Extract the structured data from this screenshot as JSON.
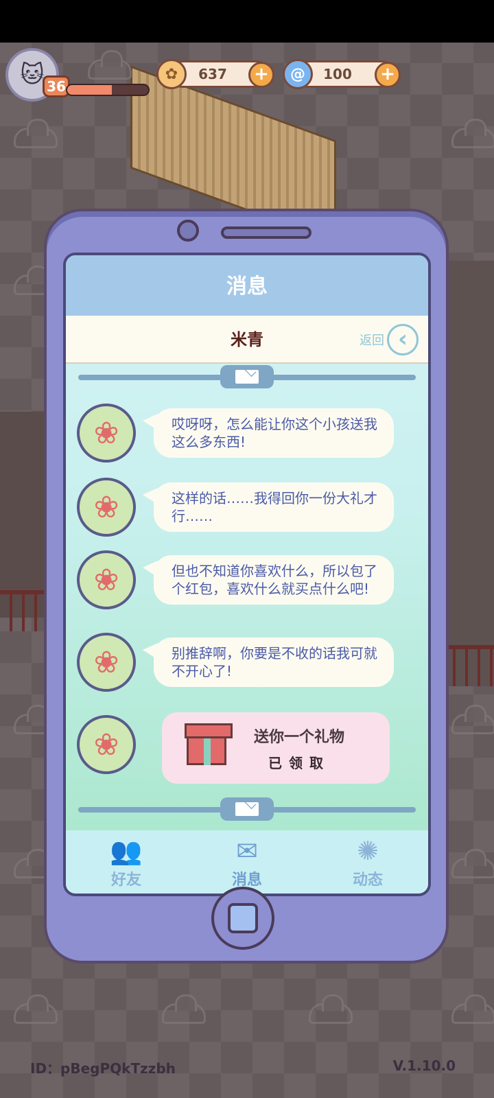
{
  "header": {
    "level": "36",
    "xp_progress": 0.55,
    "coins": "637",
    "gems": "100"
  },
  "phone": {
    "screen_title": "消息",
    "contact_name": "米青",
    "back_label": "返回",
    "messages": [
      {
        "text": "哎呀呀，怎么能让你这个小孩送我这么多东西!"
      },
      {
        "text": "这样的话……我得回你一份大礼才行……"
      },
      {
        "text": "但也不知道你喜欢什么，所以包了个红包，喜欢什么就买点什么吧!"
      },
      {
        "text": "别推辞啊，你要是不收的话我可就不开心了!"
      }
    ],
    "gift": {
      "title": "送你一个礼物",
      "status": "已领取"
    },
    "tabs": [
      {
        "label": "好友",
        "icon": "friends-icon"
      },
      {
        "label": "消息",
        "icon": "mail-icon"
      },
      {
        "label": "动态",
        "icon": "moments-icon"
      }
    ]
  },
  "footer": {
    "id": "ID：pBegPQkTzzbh",
    "version": "V.1.10.0"
  }
}
